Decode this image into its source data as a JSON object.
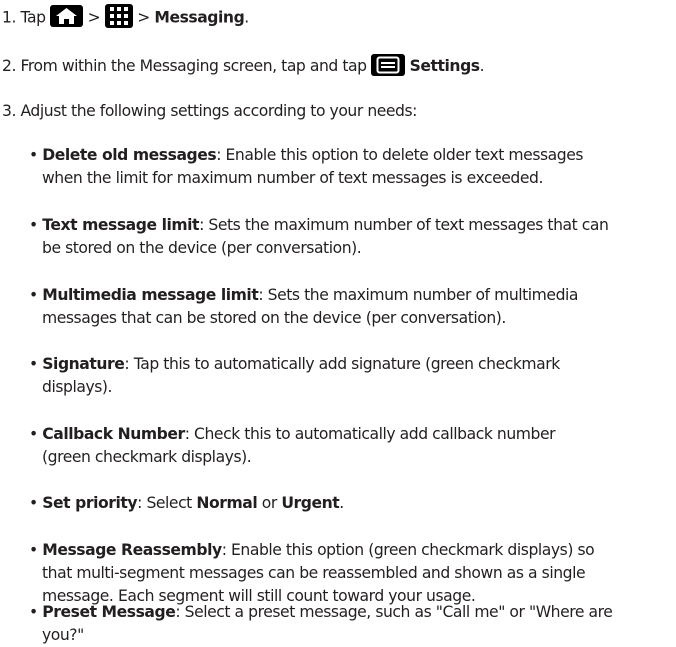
{
  "steps": {
    "s1": {
      "num": "1. Tap",
      "sep1": ">",
      "sep2": ">",
      "target": "Messaging",
      "end": "."
    },
    "s2": {
      "text_before": "2. From within the Messaging screen, tap and tap",
      "target": "Settings",
      "end": "."
    },
    "s3": {
      "text": "3. Adjust the following settings according to your needs:"
    }
  },
  "bullets": [
    {
      "term": "Delete old messages",
      "sep": ":",
      "line1": " Enable this option to delete older text messages",
      "line2": "when the limit for maximum number of text messages is exceeded."
    },
    {
      "term": "Text message limit",
      "sep": ":",
      "line1": " Sets the maximum number of text messages that can",
      "line2": "be stored on the device (per conversation)."
    },
    {
      "term": "Multimedia message limit",
      "sep": ":",
      "line1": " Sets the maximum number of multimedia",
      "line2": "messages that can be stored on the device (per conversation)."
    },
    {
      "term": "Signature",
      "sep": ":",
      "line1": " Tap this to automatically add signature (green checkmark",
      "line2": "displays)."
    },
    {
      "term": "Callback Number",
      "sep": ":",
      "line1": " Check this to automatically add callback number",
      "line2": "(green checkmark displays)."
    },
    {
      "term": "Set priority",
      "sep": ":",
      "line1a": " Select ",
      "opt1": "Normal",
      "line1b": " or ",
      "opt2": "Urgent",
      "line1c": "."
    },
    {
      "term": "Message Reassembly",
      "sep": ":",
      "line1": " Enable this option (green checkmark displays) so",
      "line2": "that multi-segment messages can be reassembled and shown as a single",
      "line3": "message. Each segment will still count toward your usage."
    },
    {
      "term": "Preset Message",
      "sep": ":",
      "line1": " Select a preset message, such as \"Call me\" or \"Where are",
      "line2": "you?\""
    }
  ],
  "icons": {
    "home": "home-icon",
    "apps": "apps-grid-icon",
    "menu": "menu-icon"
  }
}
